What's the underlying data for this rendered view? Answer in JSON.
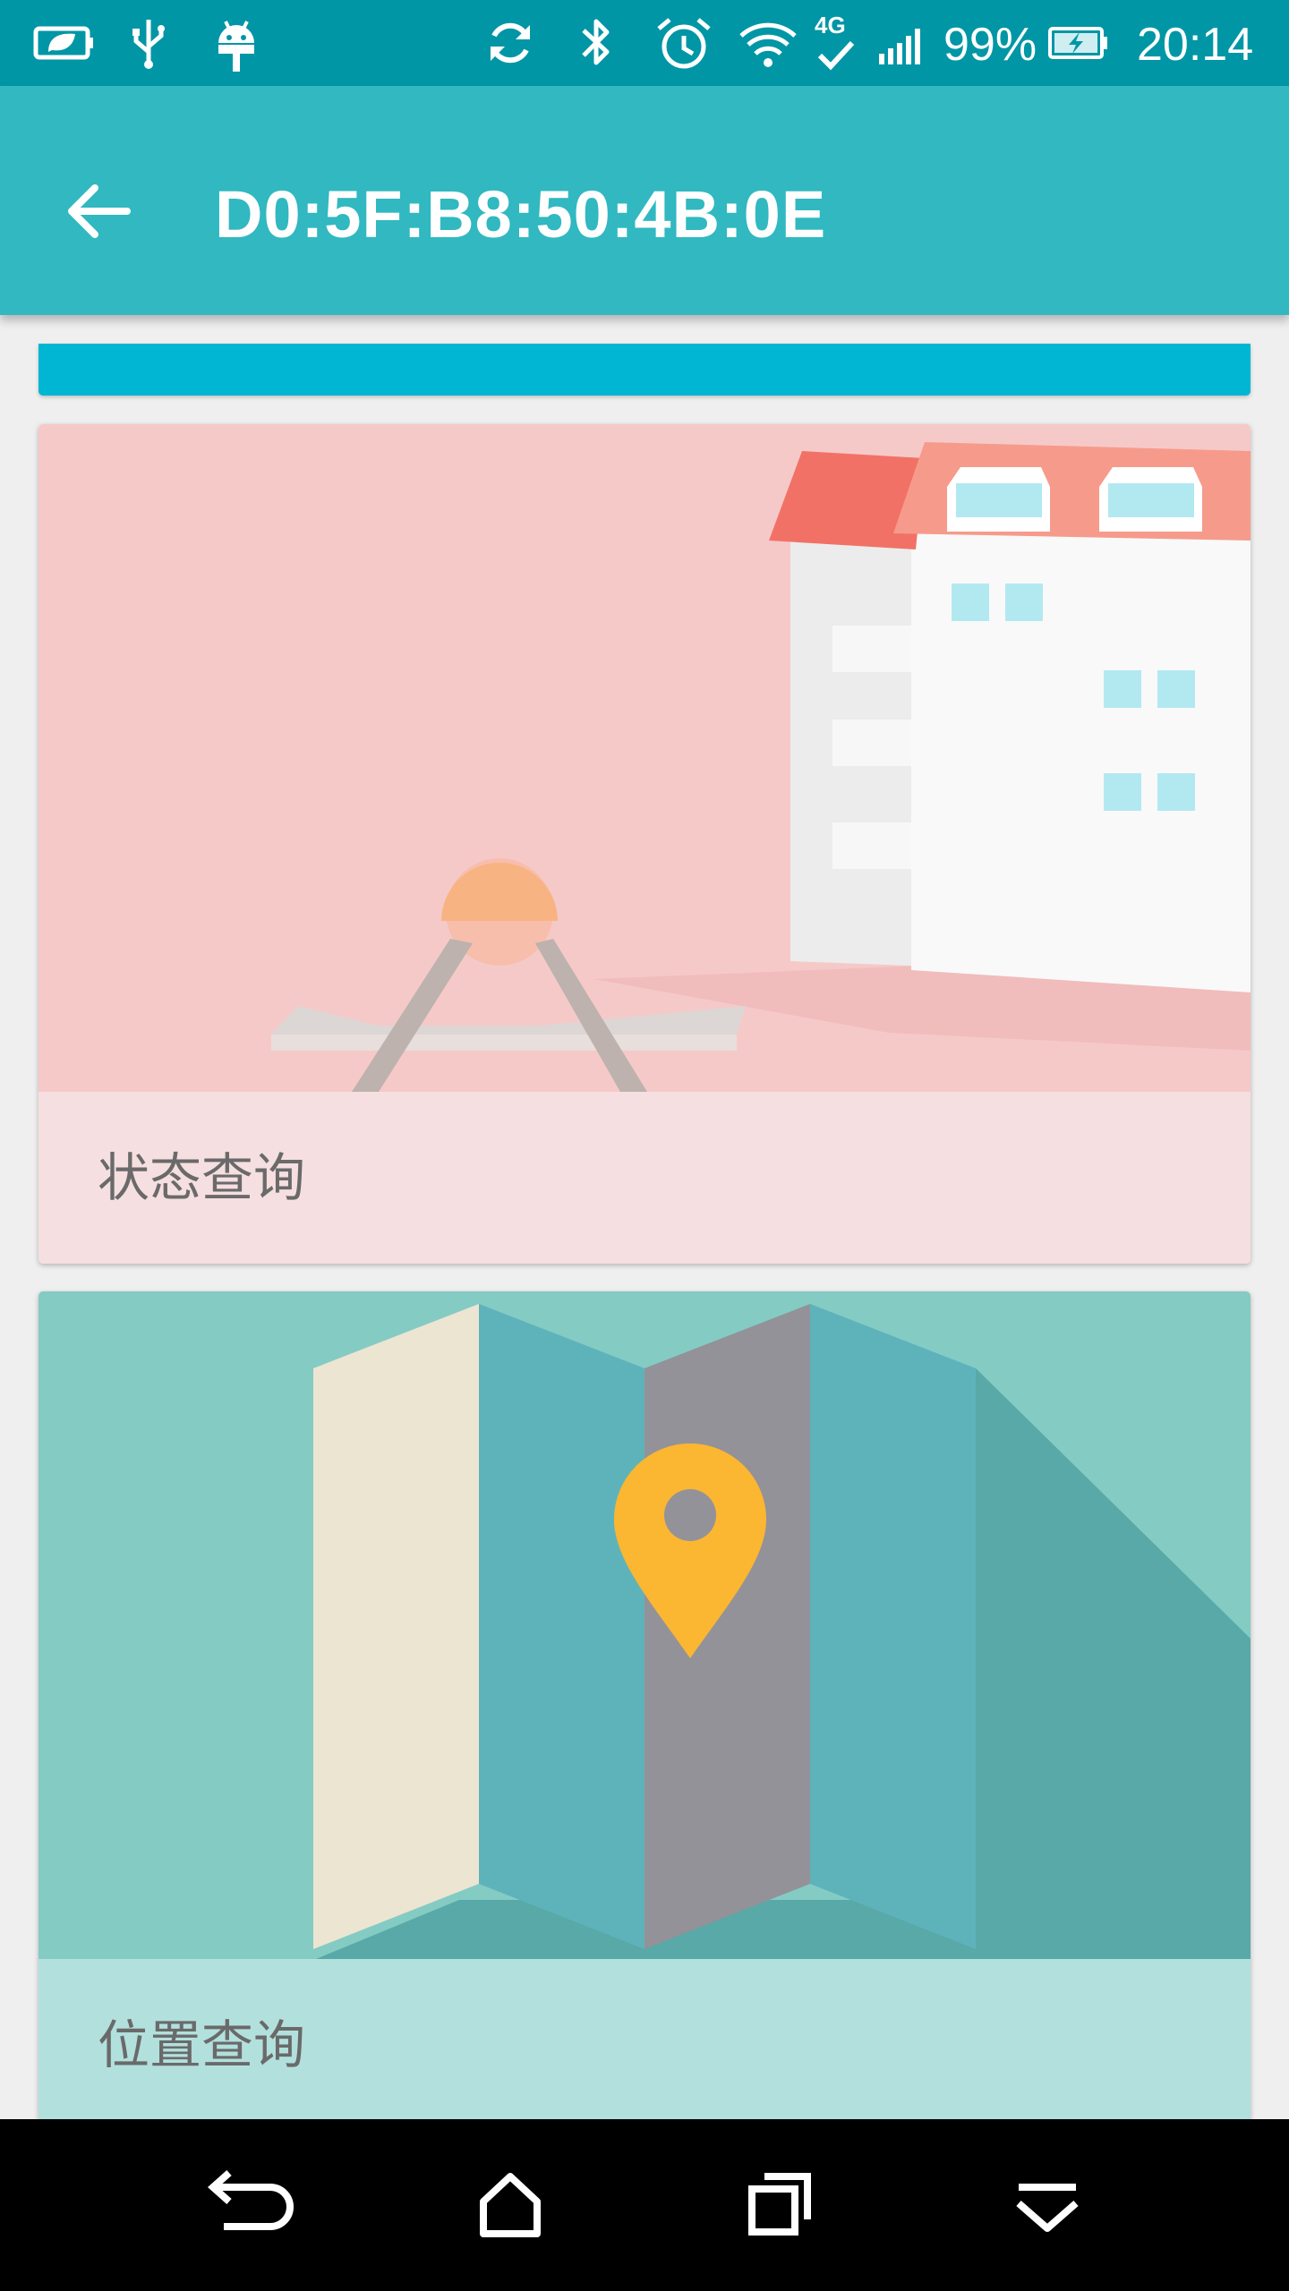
{
  "status_bar": {
    "battery_percent": "99%",
    "time": "20:14",
    "network_label": "4G",
    "icons": [
      "battery-saver-icon",
      "usb-icon",
      "android-debug-icon",
      "sync-icon",
      "bluetooth-icon",
      "alarm-icon",
      "wifi-icon",
      "lte-icon",
      "signal-icon",
      "battery-charging-icon"
    ]
  },
  "app_bar": {
    "title": "D0:5F:B8:50:4B:0E",
    "back_icon": "arrow-back-icon"
  },
  "cards": [
    {
      "label": "状态查询",
      "image": "building-illustration",
      "caption_color": "#f6dfe0",
      "image_bg": "#f6c9c9"
    },
    {
      "label": "位置查询",
      "image": "folded-map-illustration",
      "caption_color": "#b2e0dd",
      "image_bg": "#84cbc4"
    }
  ],
  "nav_bar": {
    "icons": [
      "back-icon",
      "home-icon",
      "recents-icon",
      "hide-nav-icon"
    ]
  },
  "colors": {
    "status_bar": "#0096a6",
    "app_bar": "#31b8c0",
    "strip": "#00b6d2",
    "pin": "#fbb632"
  }
}
